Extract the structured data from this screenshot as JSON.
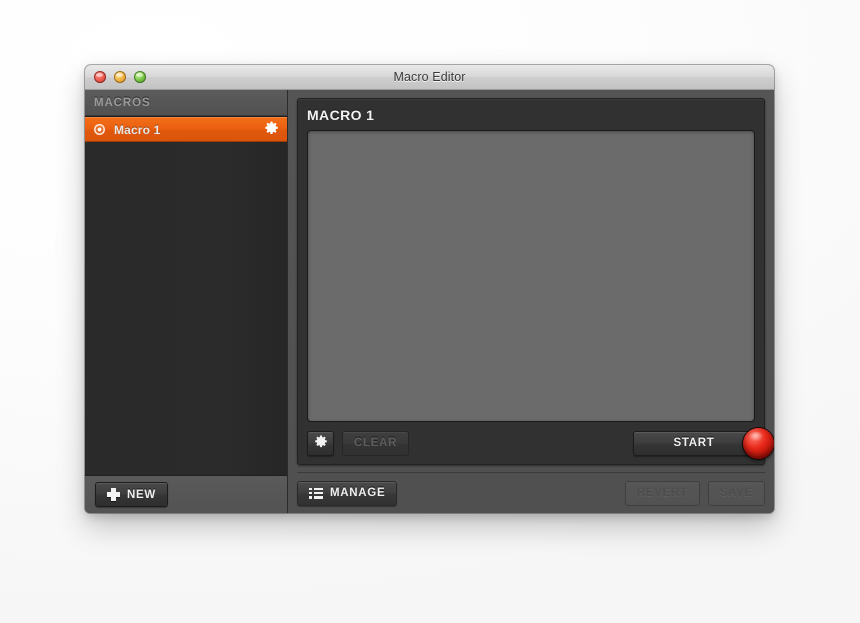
{
  "window": {
    "title": "Macro Editor",
    "traffic_lights": [
      {
        "name": "close",
        "color": "#e8574b"
      },
      {
        "name": "minimize",
        "color": "#eeae3c"
      },
      {
        "name": "zoom",
        "color": "#72c043"
      }
    ]
  },
  "sidebar": {
    "header": "MACROS",
    "items": [
      {
        "label": "Macro 1",
        "selected": true,
        "gear_icon": "gear-icon",
        "dot_icon": "record-dot-icon"
      }
    ],
    "footer": {
      "new_button": {
        "label": "NEW",
        "icon": "plus-icon",
        "disabled": false
      }
    }
  },
  "editor": {
    "title": "MACRO 1",
    "canvas": {
      "content": "",
      "background": "#6b6b6b"
    },
    "toolbar": {
      "settings_button": {
        "icon": "gear-icon",
        "label": "",
        "disabled": false
      },
      "clear_button": {
        "label": "CLEAR",
        "disabled": true
      },
      "start_button": {
        "label": "START",
        "disabled": false
      },
      "record_knob": {
        "name": "record-knob",
        "color": "#d2190c"
      }
    }
  },
  "footer": {
    "manage_button": {
      "label": "MANAGE",
      "icon": "list-icon",
      "disabled": false
    },
    "revert_button": {
      "label": "REVERT",
      "disabled": true
    },
    "save_button": {
      "label": "SAVE",
      "disabled": true
    }
  },
  "theme": {
    "accent": "#ea5f10",
    "window_chrome": "#cfcfcf",
    "sidebar_bg": "#555555",
    "list_bg": "#2a2a2a",
    "panel_bg": "#313131",
    "canvas_bg": "#6b6b6b",
    "record_red": "#d2190c"
  }
}
